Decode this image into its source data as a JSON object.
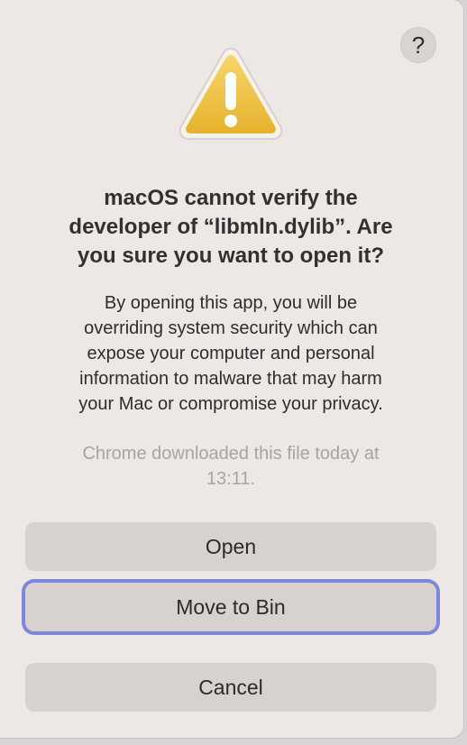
{
  "dialog": {
    "help_label": "?",
    "title": "macOS cannot verify the\ndeveloper of “libmln.dylib”. Are\nyou sure you want to open it?",
    "message": "By opening this app, you will be\noverriding system security which can\nexpose your computer and personal\ninformation to malware that may harm\nyour Mac or compromise your privacy.",
    "note": "Chrome downloaded this file today at\n13:11.",
    "buttons": {
      "open": "Open",
      "move_to_bin": "Move to Bin",
      "cancel": "Cancel"
    },
    "focused_button": "move_to_bin"
  },
  "icons": {
    "warning": "warning-triangle-icon",
    "help": "question-mark-icon"
  },
  "colors": {
    "dialog_background": "#ede8e6",
    "button_background": "#d7d2d0",
    "focus_ring": "#7b88d9",
    "warning_yellow": "#f2c53d"
  }
}
